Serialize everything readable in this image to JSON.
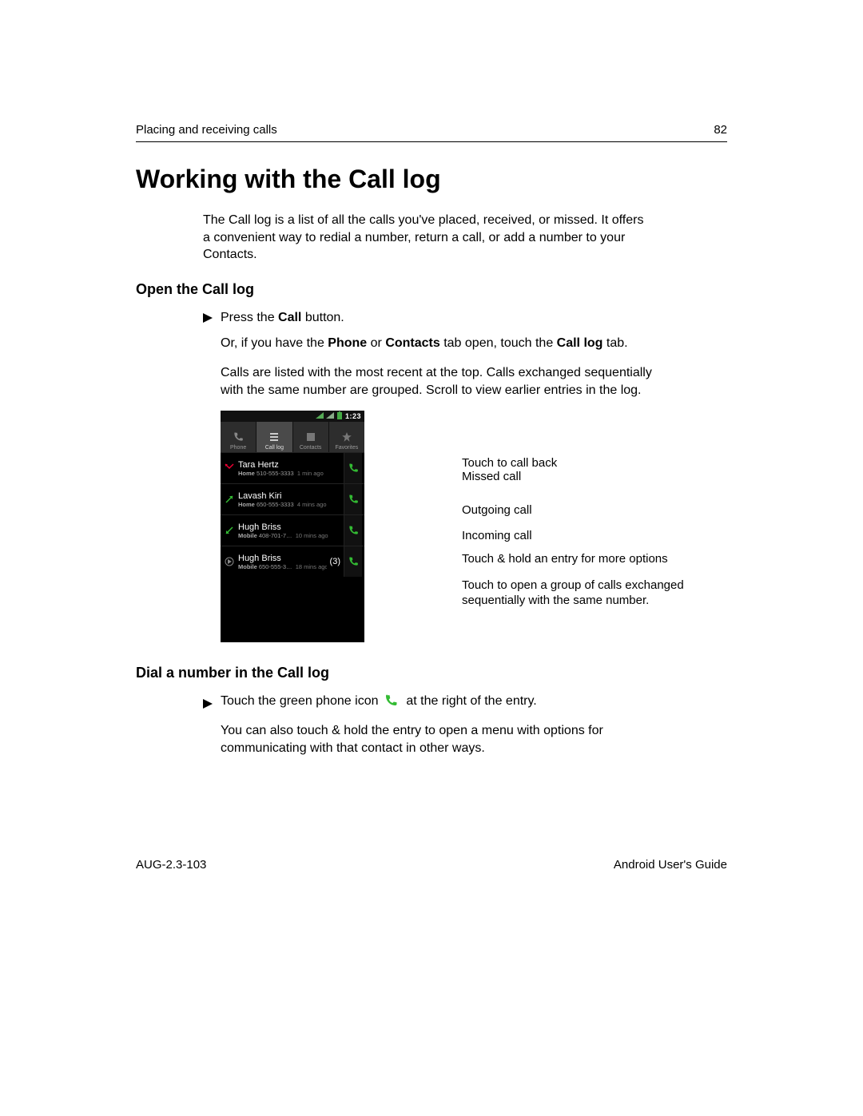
{
  "header": {
    "section": "Placing and receiving calls",
    "page_no": "82"
  },
  "h1": "Working with the Call log",
  "intro": "The Call log is a list of all the calls you've placed, received, or missed. It offers a convenient way to redial a number, return a call, or add a number to your Contacts.",
  "h2a": "Open the Call log",
  "open": {
    "step1_pre": "Press the ",
    "step1_bold": "Call",
    "step1_post": " button.",
    "p2_pre": "Or, if you have the ",
    "p2_b1": "Phone",
    "p2_mid1": " or ",
    "p2_b2": "Contacts",
    "p2_mid2": " tab open, touch the ",
    "p2_b3": "Call log",
    "p2_post": " tab.",
    "p3": "Calls are listed with the most recent at the top. Calls exchanged sequentially with the same number are grouped. Scroll to view earlier entries in the log."
  },
  "phone": {
    "status_time": "1:23",
    "tabs": [
      {
        "label": "Phone"
      },
      {
        "label": "Call log"
      },
      {
        "label": "Contacts"
      },
      {
        "label": "Favorites"
      }
    ],
    "entries": [
      {
        "name": "Tara Hertz",
        "label": "Home",
        "number": "510-555-3333",
        "time": "1 min ago",
        "count": "",
        "type": "missed"
      },
      {
        "name": "Lavash Kiri",
        "label": "Home",
        "number": "650-555-3333",
        "time": "4 mins ago",
        "count": "",
        "type": "outgoing"
      },
      {
        "name": "Hugh Briss",
        "label": "Mobile",
        "number": "408-701-7…",
        "time": "10 mins ago",
        "count": "",
        "type": "incoming"
      },
      {
        "name": "Hugh Briss",
        "label": "Mobile",
        "number": "650-555-3…",
        "time": "18 mins ago",
        "count": "(3)",
        "type": "group"
      }
    ]
  },
  "callouts": {
    "c1": "Touch to call back",
    "c2": "Missed call",
    "c3": "Outgoing call",
    "c4": "Incoming call",
    "c5": "Touch & hold an entry for more options",
    "c6": "Touch to open a group of calls exchanged sequentially with the same number."
  },
  "h2b": "Dial a number in the Call log",
  "dial": {
    "step1_pre": "Touch the green phone icon",
    "step1_post": "at the right of the entry.",
    "p2": "You can also touch & hold the entry to open a menu with options for communicating with that contact in other ways."
  },
  "footer": {
    "left": "AUG-2.3-103",
    "right": "Android User's Guide"
  }
}
